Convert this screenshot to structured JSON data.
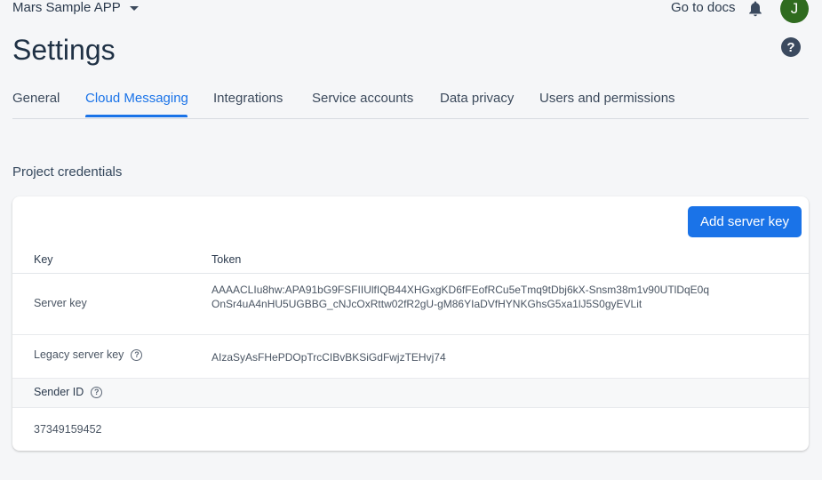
{
  "header": {
    "project_name": "Mars Sample APP",
    "docs_link": "Go to docs",
    "avatar_initial": "J"
  },
  "page": {
    "title": "Settings",
    "help_glyph": "?"
  },
  "tabs": [
    {
      "label": "General"
    },
    {
      "label": "Cloud Messaging",
      "active": true
    },
    {
      "label": "Integrations"
    },
    {
      "label": "Service accounts"
    },
    {
      "label": "Data privacy"
    },
    {
      "label": "Users and permissions"
    }
  ],
  "credentials": {
    "section_title": "Project credentials",
    "add_button": "Add server key",
    "columns": {
      "key": "Key",
      "token": "Token"
    },
    "rows": [
      {
        "key": "Server key",
        "token": "AAAACLIu8hw:APA91bG9FSFIIUlfIQB44XHGxgKD6fFEofRCu5eTmq9tDbj6kX-Snsm38m1v90UTlDqE0qOnSr4uA4nHU5UGBBG_cNJcOxRttw02fR2gU-gM86YIaDVfHYNKGhsG5xa1lJ5S0gyEVLit"
      },
      {
        "key": "Legacy server key",
        "token": "AIzaSyAsFHePDOpTrcCIBvBKSiGdFwjzTEHvj74"
      }
    ],
    "sender": {
      "label": "Sender ID",
      "value": "37349159452"
    }
  },
  "colors": {
    "accent": "#1a73e8",
    "avatar_bg": "#2f6b1f",
    "background": "#f5f6f8"
  },
  "icons": {
    "caret": "chevron-down-icon",
    "bell": "bell-icon",
    "help": "help-icon",
    "info": "question-circle-icon"
  }
}
